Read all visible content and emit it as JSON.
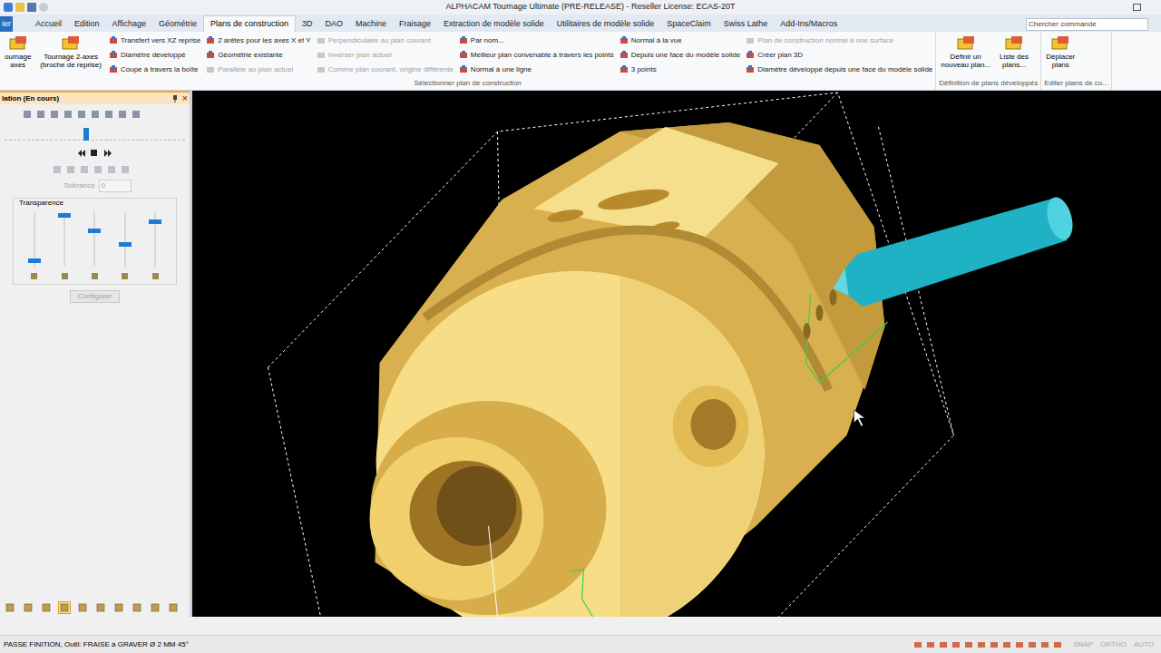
{
  "window": {
    "title": "ALPHACAM Tournage Ultimate (PRE-RELEASE) - Reseller License: ECAS-20T"
  },
  "tabs": [
    {
      "label": "ier",
      "selected": false,
      "kind": "file"
    },
    {
      "label": "Accueil",
      "selected": false,
      "kind": "tab"
    },
    {
      "label": "Edition",
      "selected": false,
      "kind": "tab"
    },
    {
      "label": "Affichage",
      "selected": false,
      "kind": "tab"
    },
    {
      "label": "Géométrie",
      "selected": false,
      "kind": "tab"
    },
    {
      "label": "Plans de construction",
      "selected": true,
      "kind": "tab"
    },
    {
      "label": "3D",
      "selected": false,
      "kind": "tab"
    },
    {
      "label": "DAO",
      "selected": false,
      "kind": "tab"
    },
    {
      "label": "Machine",
      "selected": false,
      "kind": "tab"
    },
    {
      "label": "Fraisage",
      "selected": false,
      "kind": "tab"
    },
    {
      "label": "Extraction de modèle solide",
      "selected": false,
      "kind": "tab"
    },
    {
      "label": "Utilitaires de modèle solide",
      "selected": false,
      "kind": "tab"
    },
    {
      "label": "SpaceClaim",
      "selected": false,
      "kind": "tab"
    },
    {
      "label": "Swiss Lathe",
      "selected": false,
      "kind": "tab"
    },
    {
      "label": "Add-Ins/Macros",
      "selected": false,
      "kind": "tab"
    }
  ],
  "search": {
    "placeholder": "Chercher commande"
  },
  "ribbon": {
    "groups": [
      {
        "label": "Sélectionner plan de construction",
        "large": [
          {
            "label": "ournage\naxes"
          },
          {
            "label": "Tournage 2-axes\n(broche de reprise)"
          }
        ],
        "columns": [
          [
            {
              "label": "Transfert vers XZ reprise",
              "disabled": false
            },
            {
              "label": "Diamètre développé",
              "disabled": false
            },
            {
              "label": "Coupe à travers la boîte",
              "disabled": false
            }
          ],
          [
            {
              "label": "2 arêtes pour les axes X et Y",
              "disabled": false
            },
            {
              "label": "Géométrie existante",
              "disabled": false
            },
            {
              "label": "Parallèle au plan actuel",
              "disabled": true
            }
          ],
          [
            {
              "label": "Perpendiculaire au plan courant",
              "disabled": true
            },
            {
              "label": "Inverser plan actuel",
              "disabled": true
            },
            {
              "label": "Comme plan courant, origine différente",
              "disabled": true
            }
          ],
          [
            {
              "label": "Par nom...",
              "disabled": false
            },
            {
              "label": "Meilleur plan convenable à travers les points",
              "disabled": false
            },
            {
              "label": "Normal à une ligne",
              "disabled": false
            }
          ],
          [
            {
              "label": "Normal à la vue",
              "disabled": false
            },
            {
              "label": "Depuis une face du modèle solide",
              "disabled": false
            },
            {
              "label": "3 points",
              "disabled": false
            }
          ],
          [
            {
              "label": "Plan de construction normal à une surface",
              "disabled": true
            },
            {
              "label": "Créer plan 3D",
              "disabled": false
            },
            {
              "label": "Diamètre développé depuis une face du modèle solide",
              "disabled": false
            }
          ]
        ]
      },
      {
        "label": "Définition de plans développés",
        "large": [
          {
            "label": "Définir un\nnouveau plan..."
          },
          {
            "label": "Liste des\nplans..."
          }
        ],
        "columns": []
      },
      {
        "label": "Editer plans de co...",
        "large": [
          {
            "label": "Déplacer\nplans"
          }
        ],
        "columns": []
      }
    ]
  },
  "panel": {
    "title": "lation (En cours)",
    "close": "×",
    "position": {
      "level": 0.45
    },
    "tolerance": {
      "label": "Tolérance",
      "value": "0",
      "disabled": true
    },
    "transparency": {
      "label": "Transparence",
      "sliders": [
        {
          "level": 0.07
        },
        {
          "level": 0.98
        },
        {
          "level": 0.68
        },
        {
          "level": 0.4
        },
        {
          "level": 0.85
        }
      ]
    },
    "configure": {
      "label": "Configurer",
      "disabled": true
    },
    "tools": [
      {
        "selected": false
      },
      {
        "selected": false
      },
      {
        "selected": false
      },
      {
        "selected": true
      },
      {
        "selected": false
      },
      {
        "selected": false
      },
      {
        "selected": false
      },
      {
        "selected": false
      },
      {
        "selected": false
      },
      {
        "selected": false
      }
    ]
  },
  "status": {
    "text": "PASSE FINITION, Outil: FRAISE à GRAVER Ø 2 MM 45°",
    "indicators": [
      {
        "label": "SNAP",
        "on": false
      },
      {
        "label": "ORTHO",
        "on": false
      },
      {
        "label": "AUTO",
        "on": false
      }
    ]
  }
}
